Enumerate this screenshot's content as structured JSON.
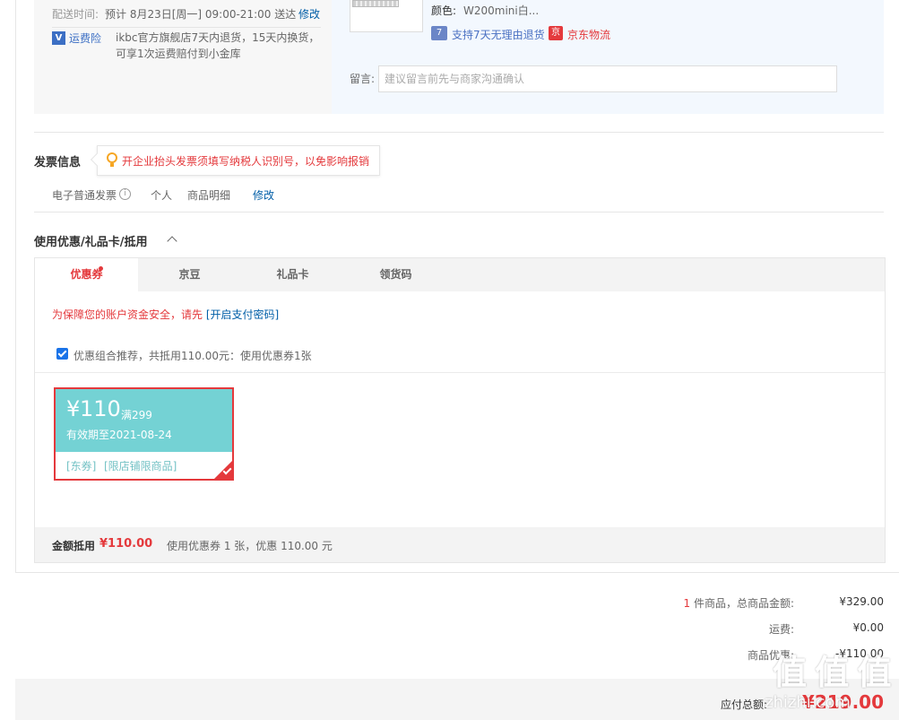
{
  "shipping": {
    "delivery_label": "配送时间:",
    "delivery_value": "预计 8月23日[周一] 09:00-21:00 送达",
    "edit_label": "修改",
    "insurance_icon": "V",
    "insurance_label": "运费险",
    "insurance_text": "ikbc官方旗舰店7天内退货，15天内换货，可享1次运费赔付到小金库"
  },
  "product": {
    "image_icon": "keyboard-icon",
    "color_label": "颜色:",
    "color_value": "W200mini白...",
    "return_icon": "7",
    "return_text": "支持7天无理由退货",
    "logistics_icon": "京",
    "logistics_text": "京东物流",
    "message_label": "留言:",
    "message_placeholder": "建议留言前先与商家沟通确认"
  },
  "invoice": {
    "title": "发票信息",
    "tip": "开企业抬头发票须填写纳税人识别号，以免影响报销",
    "type": "电子普通发票",
    "info_icon": "i",
    "header": "个人",
    "content": "商品明细",
    "edit_label": "修改"
  },
  "coupons": {
    "title": "使用优惠/礼品卡/抵用",
    "tabs": [
      {
        "label": "优惠券"
      },
      {
        "label": "京豆"
      },
      {
        "label": "礼品卡"
      },
      {
        "label": "领货码"
      }
    ],
    "warning_text": "为保障您的账户资金安全，请先 ",
    "warning_link": "[开启支付密码]",
    "combo_text": "优惠组合推荐，共抵用110.00元：使用优惠券1张",
    "card": {
      "currency": "¥",
      "amount": "110",
      "condition": "满299",
      "valid": "有效期至2021-08-24",
      "tag1": "[东券]",
      "tag2": "[限店铺限商品]"
    },
    "summary_label": "金额抵用",
    "summary_amount": "¥110.00",
    "summary_desc": "使用优惠券 1 张，优惠 110.00 元"
  },
  "totals": {
    "count": "1",
    "goods_label": "件商品，总商品金额:",
    "goods_value": "¥329.00",
    "shipping_label": "运费:",
    "shipping_value": "¥0.00",
    "discount_label": "商品优惠:",
    "discount_value": "-¥110.00",
    "payable_label": "应付总额:",
    "payable_value": "¥219.00"
  },
  "watermark": {
    "logo": "值 值 值",
    "site": "zhizhi.com"
  },
  "colors": {
    "accent_red": "#e4393c",
    "link_blue": "#005ea7",
    "coupon_teal": "#74d2d4"
  }
}
